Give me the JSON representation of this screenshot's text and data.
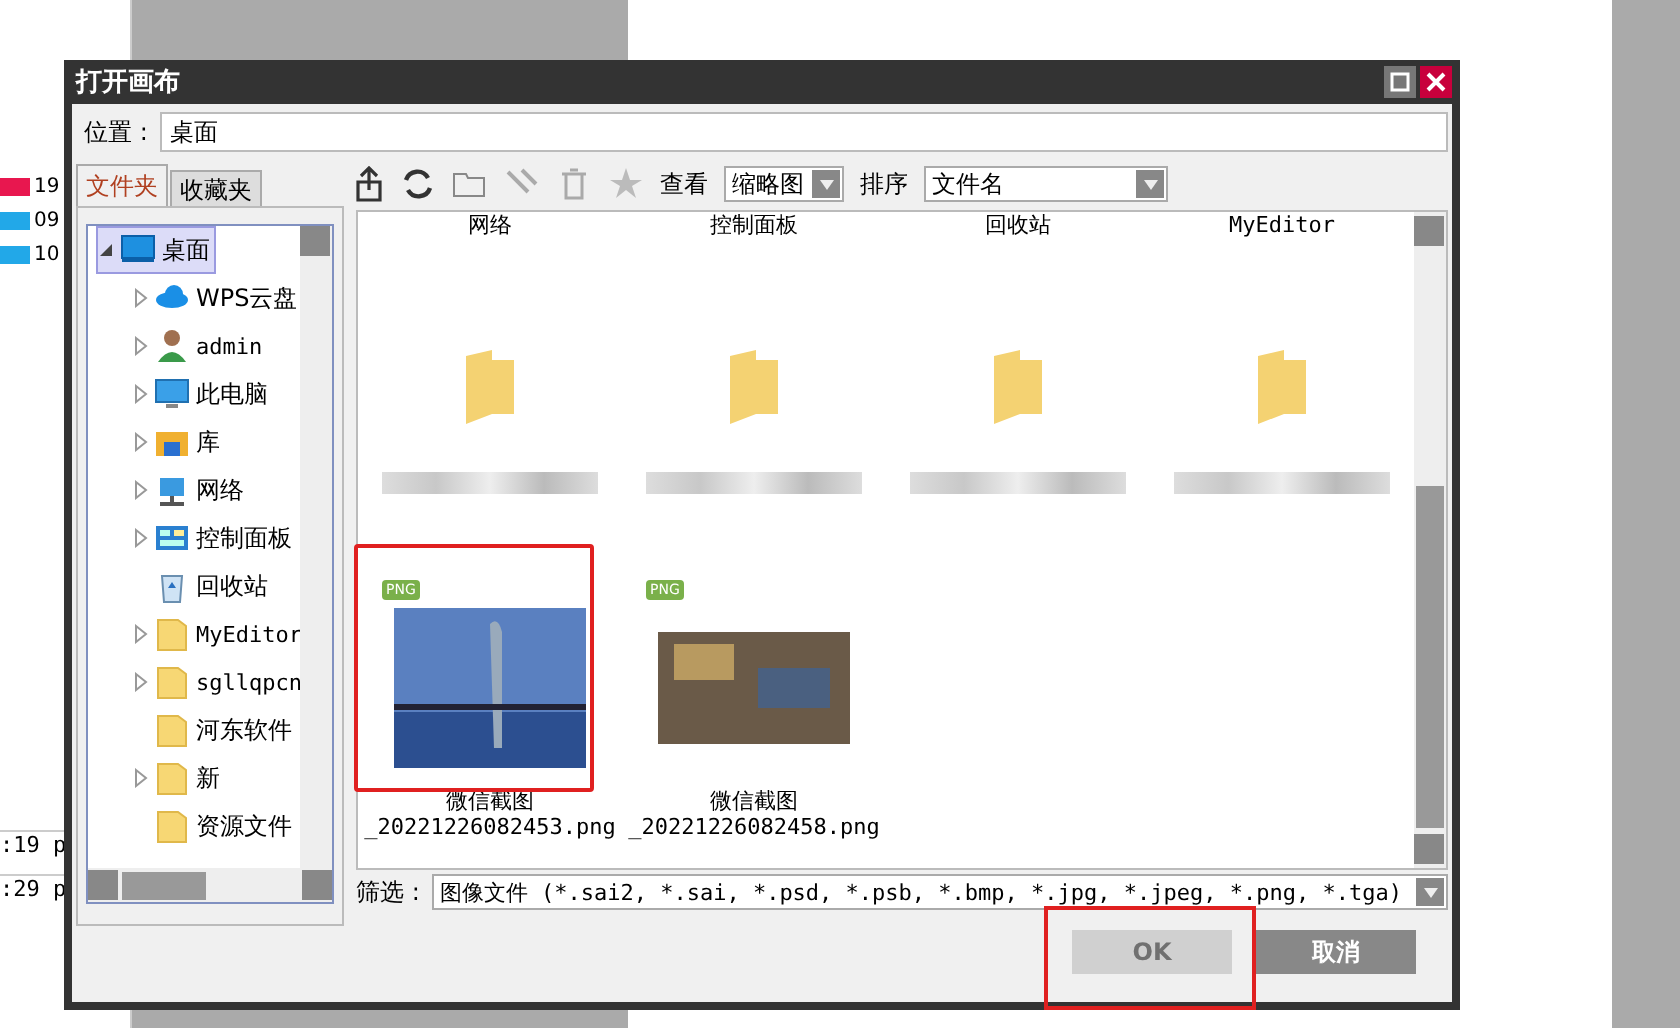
{
  "background_app": {
    "values": [
      "19",
      "09",
      "10"
    ],
    "size_texts": [
      ":19 p",
      ":29 p"
    ]
  },
  "window": {
    "title": "打开画布"
  },
  "location": {
    "label": "位置 :",
    "value": "桌面"
  },
  "tabs": [
    {
      "label": "文件夹",
      "selected": true
    },
    {
      "label": "收藏夹",
      "selected": false
    }
  ],
  "tree": [
    {
      "label": "桌面",
      "kind": "desktop",
      "expanded": true,
      "selected": true,
      "children": [
        {
          "label": "WPS云盘",
          "kind": "cloud",
          "expandable": true,
          "selected": false
        },
        {
          "label": "admin",
          "kind": "user",
          "expandable": true,
          "selected": false
        },
        {
          "label": "此电脑",
          "kind": "computer",
          "expandable": true,
          "selected": false
        },
        {
          "label": "库",
          "kind": "library",
          "expandable": true,
          "selected": false
        },
        {
          "label": "网络",
          "kind": "network",
          "expandable": true,
          "selected": false
        },
        {
          "label": "控制面板",
          "kind": "control-panel",
          "expandable": true,
          "selected": false
        },
        {
          "label": "回收站",
          "kind": "recycle-bin",
          "expandable": false,
          "selected": false
        },
        {
          "label": "MyEditor",
          "kind": "folder",
          "expandable": true,
          "selected": false
        },
        {
          "label": "sgllqpcn",
          "kind": "folder",
          "expandable": true,
          "selected": false
        },
        {
          "label": "河东软件",
          "kind": "folder",
          "expandable": false,
          "selected": false
        },
        {
          "label": "新",
          "kind": "folder",
          "expandable": true,
          "selected": false
        },
        {
          "label": "资源文件",
          "kind": "folder",
          "expandable": false,
          "selected": false
        }
      ]
    }
  ],
  "toolbar": {
    "view_label": "查看",
    "view_value": "缩略图",
    "sort_label": "排序",
    "sort_value": "文件名"
  },
  "files": [
    {
      "kind": "label-only",
      "label": "网络"
    },
    {
      "kind": "label-only",
      "label": "控制面板"
    },
    {
      "kind": "label-only",
      "label": "回收站"
    },
    {
      "kind": "label-only",
      "label": "MyEditor"
    },
    {
      "kind": "folder"
    },
    {
      "kind": "folder"
    },
    {
      "kind": "folder"
    },
    {
      "kind": "folder"
    },
    {
      "kind": "image",
      "badge": "PNG",
      "label": "微信截图",
      "sublabel": "_20221226082453.png",
      "highlighted": true
    },
    {
      "kind": "image",
      "badge": "PNG",
      "label": "微信截图",
      "sublabel": "_20221226082458.png",
      "highlighted": false
    }
  ],
  "filter": {
    "label": "筛选 :",
    "value": "图像文件 (*.sai2, *.sai, *.psd, *.psb, *.bmp, *.jpg, *.jpeg, *.png, *.tga)"
  },
  "buttons": [
    {
      "label": "OK",
      "disabled": true,
      "highlighted": true
    },
    {
      "label": "取消",
      "disabled": false,
      "highlighted": false
    }
  ]
}
